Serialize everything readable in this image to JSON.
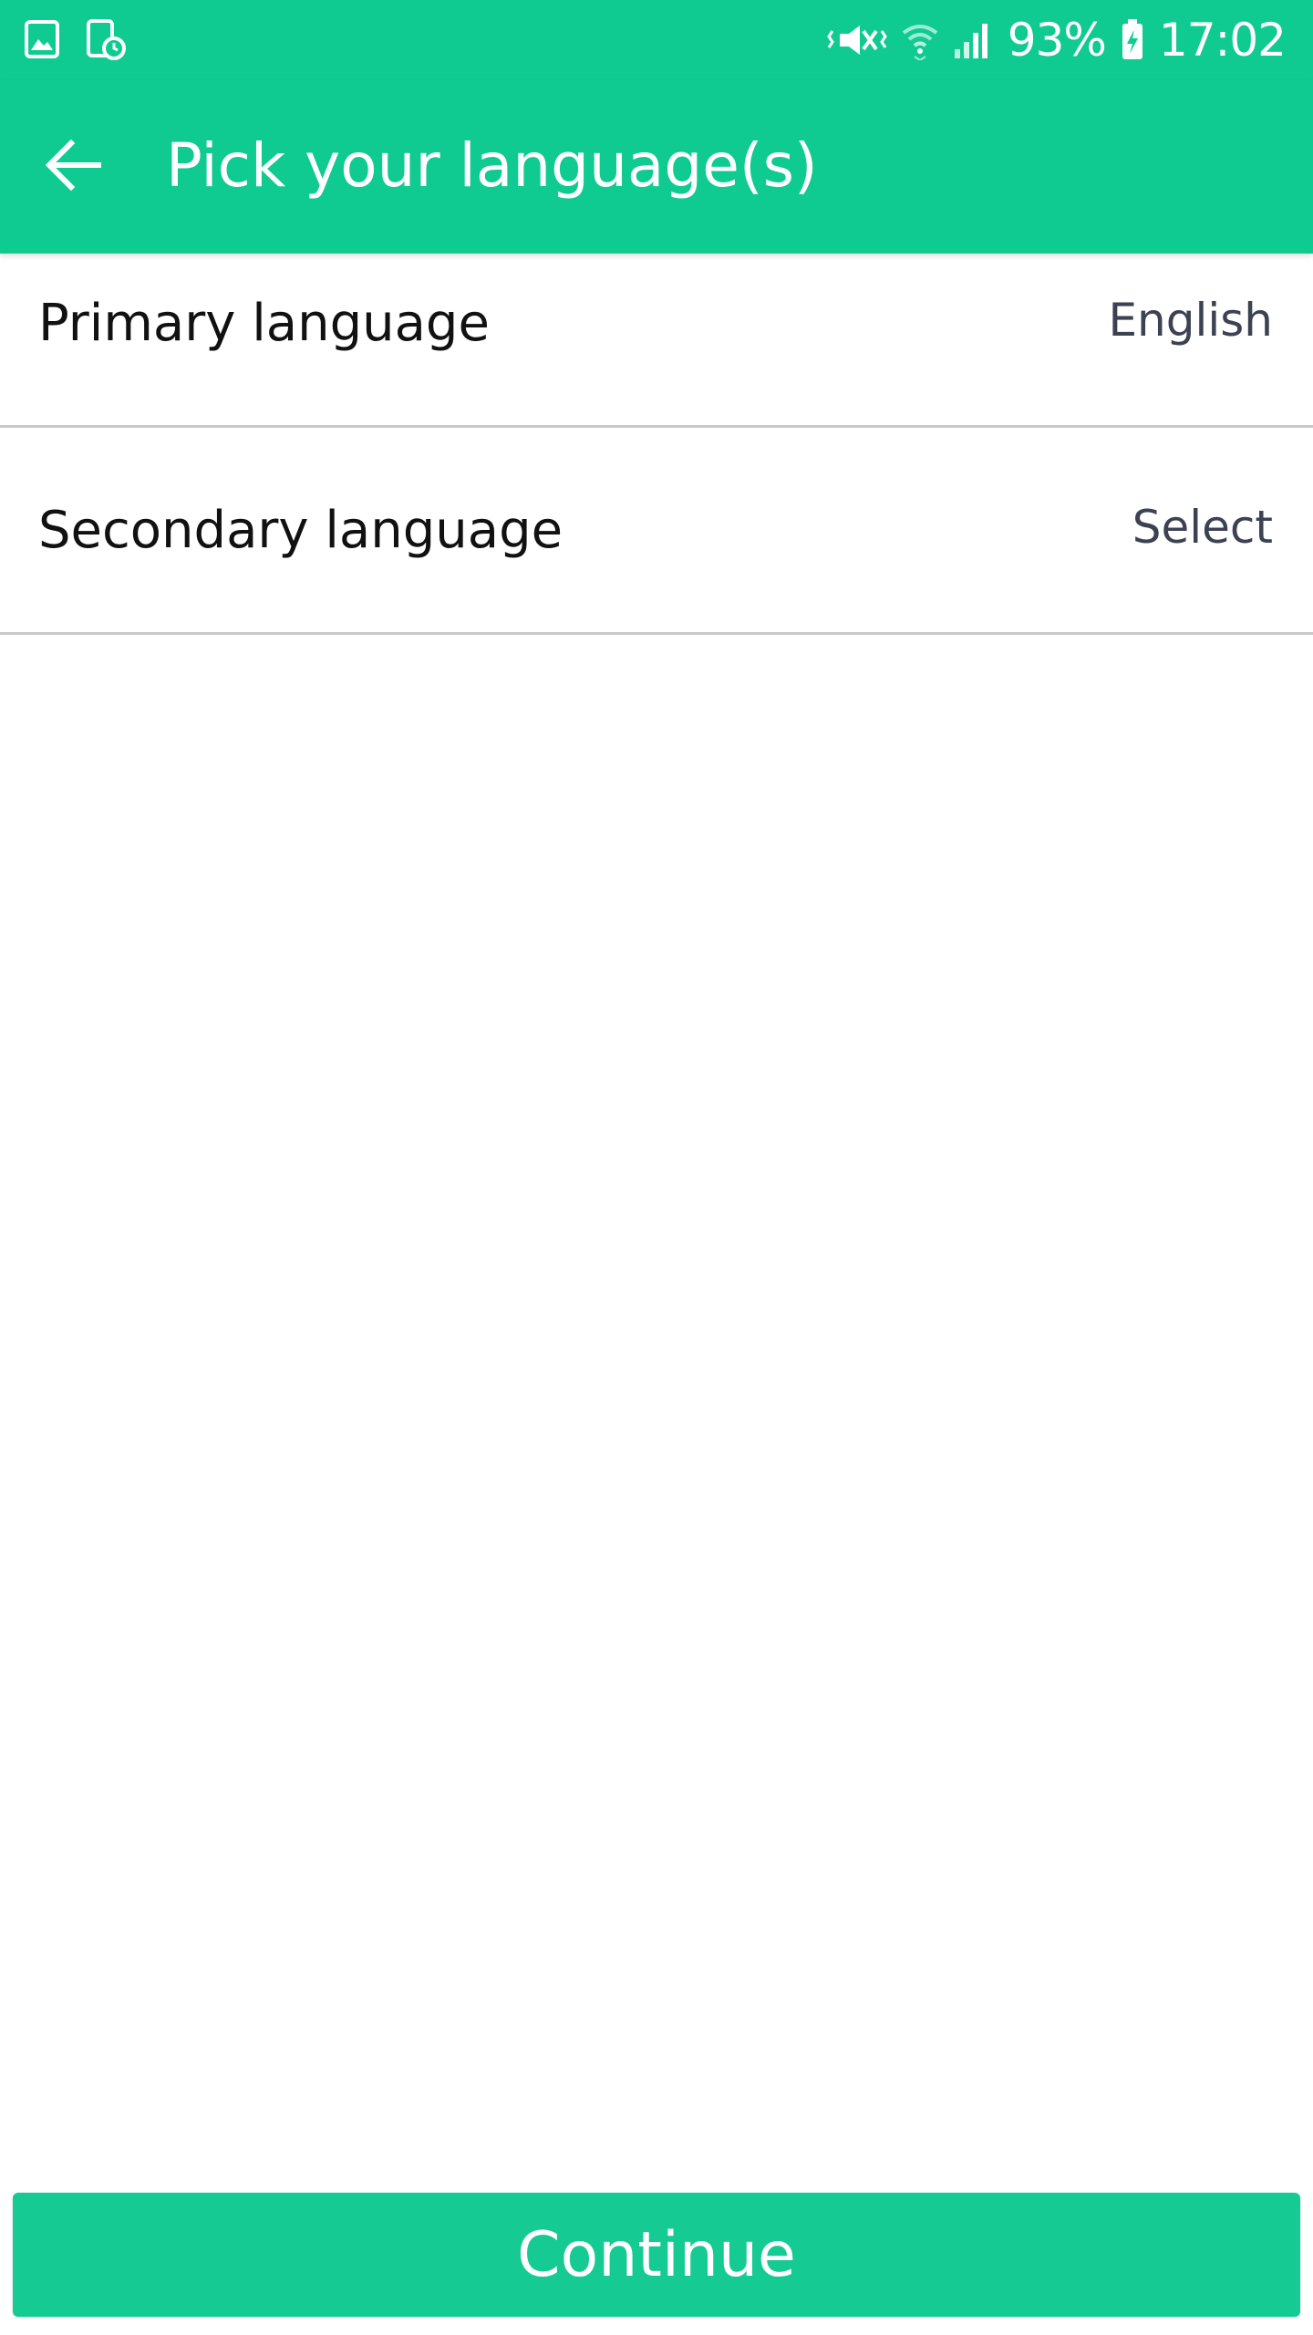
{
  "status_bar": {
    "battery_percent": "93%",
    "time": "17:02",
    "left_icons": [
      "gallery-notification-icon",
      "tablet-clock-notification-icon"
    ],
    "right_icons": [
      "vibrate-mute-icon",
      "wifi-icon",
      "signal-icon",
      "battery-charging-icon"
    ]
  },
  "app_bar": {
    "title": "Pick your language(s)",
    "back_icon": "arrow-left-icon"
  },
  "settings": {
    "items": [
      {
        "label": "Primary language",
        "value": "English"
      },
      {
        "label": "Secondary language",
        "value": "Select"
      }
    ]
  },
  "footer": {
    "continue_label": "Continue"
  },
  "colors": {
    "brand_green": "#10cb91",
    "button_green": "#16ca93",
    "divider": "#c7c9cc",
    "value_text": "#3c4252"
  }
}
